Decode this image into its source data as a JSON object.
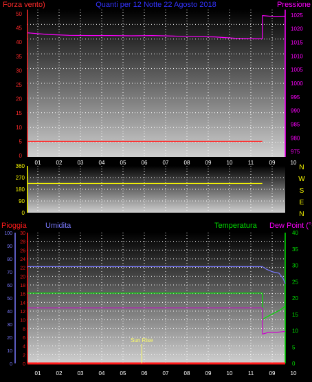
{
  "colors": {
    "wind": "#ff2a2a",
    "pressure": "#ff00ff",
    "title": "#3333ff",
    "direction": "#ffff00",
    "humidity": "#7a7aff",
    "temperature": "#00e000",
    "dewpoint": "#cc00cc",
    "rain": "#ff1a1a",
    "sunrise": "#ffff66",
    "grid": "#ffffff"
  },
  "chart_data": [
    {
      "type": "line",
      "title": "Quanti per 12 Notte 22 Agosto 2018",
      "left_axis_label": "Forza vento)",
      "right_axis_label": "Pressione",
      "x_tick_labels": [
        "01",
        "02",
        "03",
        "04",
        "05",
        "06",
        "07",
        "08",
        "09",
        "10",
        "11",
        "09",
        "10"
      ],
      "y_left_ticks": [
        "0",
        "5",
        "10",
        "15",
        "20",
        "25",
        "30",
        "35",
        "40",
        "45",
        "50"
      ],
      "y_left_range": [
        0,
        50
      ],
      "y_right_ticks": [
        "975",
        "980",
        "985",
        "990",
        "995",
        "1000",
        "1005",
        "1010",
        "1015",
        "1020",
        "1025"
      ],
      "y_right_range": [
        973,
        1027
      ],
      "grid": true,
      "series": [
        {
          "name": "Pressione",
          "axis": "right",
          "x": [
            0,
            1,
            2,
            3,
            4,
            5,
            6,
            7,
            8,
            9,
            10,
            11,
            11.3,
            11.31,
            11.8,
            12.4
          ],
          "values": [
            1018.5,
            1017.9,
            1017.6,
            1017.5,
            1017.5,
            1017.4,
            1017.5,
            1017.3,
            1017.1,
            1017.0,
            1016.5,
            1016.3,
            1016.3,
            1024.8,
            1024.5,
            1024.6
          ]
        },
        {
          "name": "Forza vento",
          "axis": "left",
          "x": [
            0,
            11.3
          ],
          "values": [
            5,
            5
          ]
        }
      ]
    },
    {
      "type": "line",
      "title": "",
      "y_left_ticks": [
        "0",
        "90",
        "180",
        "270",
        "360"
      ],
      "y_range": [
        0,
        360
      ],
      "compass_labels": [
        "N",
        "W",
        "S",
        "E",
        "N"
      ],
      "grid": true,
      "series": [
        {
          "name": "Direzione",
          "x": [
            0,
            11.3
          ],
          "values": [
            225,
            225
          ]
        }
      ]
    },
    {
      "type": "line",
      "title": "",
      "labels": {
        "rain": "Pioggia",
        "humidity": "Umidita",
        "temperature": "Temperatura",
        "dewpoint": "Dew Point (°C)"
      },
      "y_rain_ticks": [
        "0",
        "2",
        "4",
        "6",
        "8",
        "10",
        "12",
        "14",
        "16",
        "18",
        "20",
        "22",
        "24",
        "26",
        "28",
        "30"
      ],
      "y_rain_range": [
        0,
        30
      ],
      "y_humidity_ticks": [
        "0",
        "10",
        "20",
        "30",
        "40",
        "50",
        "60",
        "70",
        "80",
        "90",
        "100"
      ],
      "y_humidity_range": [
        0,
        100
      ],
      "y_temp_ticks": [
        "0",
        "5",
        "10",
        "15",
        "20",
        "25",
        "30",
        "35",
        "40"
      ],
      "y_temp_range": [
        0,
        40
      ],
      "x_tick_labels": [
        "01",
        "02",
        "03",
        "04",
        "05",
        "06",
        "07",
        "08",
        "09",
        "10",
        "11",
        "09",
        "10"
      ],
      "annotation": "Sun Rise",
      "annotation_x": 5.5,
      "grid": true,
      "series": [
        {
          "name": "Umidita",
          "axis": "humidity",
          "x": [
            0,
            11.3,
            11.5,
            11.8,
            12.1,
            12.3,
            12.4
          ],
          "values": [
            74,
            74,
            72,
            70,
            69,
            65,
            61
          ]
        },
        {
          "name": "Temperatura",
          "axis": "temp",
          "x": [
            0,
            11.3,
            11.31,
            11.6,
            11.9,
            12.2,
            12.4
          ],
          "values": [
            21.5,
            21.5,
            13.5,
            14.5,
            15.5,
            16.5,
            17.5
          ]
        },
        {
          "name": "Dew Point",
          "axis": "temp",
          "x": [
            0,
            11.3,
            11.31,
            11.6,
            12.0,
            12.4
          ],
          "values": [
            17,
            17,
            9,
            9.5,
            9.5,
            9.8
          ]
        },
        {
          "name": "Pioggia",
          "axis": "rain",
          "x": [
            0,
            12.4
          ],
          "values": [
            0,
            0
          ]
        }
      ]
    }
  ]
}
